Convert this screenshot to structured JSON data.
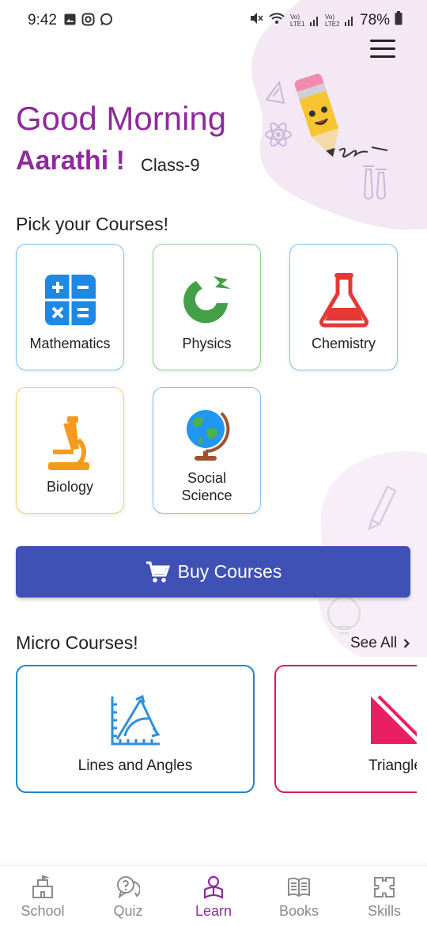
{
  "status_bar": {
    "time": "9:42",
    "battery": "78%",
    "sim1": "Vo) LTE1",
    "sim2": "Vo) LTE2",
    "left_icons": [
      "gallery-icon",
      "instagram-icon",
      "whatsapp-icon"
    ],
    "right_icons": [
      "mute-icon",
      "wifi-icon",
      "signal-icon",
      "signal-icon",
      "battery-icon"
    ]
  },
  "header": {
    "greeting": "Good Morning",
    "user_name": "Aarathi !",
    "class_label": "Class-9",
    "menu_icon": "hamburger-menu-icon"
  },
  "courses_section": {
    "title": "Pick your Courses!",
    "courses": [
      {
        "label": "Mathematics",
        "icon": "calculator-icon",
        "border_color": "#4aa7e3"
      },
      {
        "label": "Physics",
        "icon": "magnet-icon",
        "border_color": "#5cb85c"
      },
      {
        "label": "Chemistry",
        "icon": "flask-icon",
        "border_color": "#4aa7e3"
      },
      {
        "label": "Biology",
        "icon": "microscope-icon",
        "border_color": "#f2c744"
      },
      {
        "label": "Social Science",
        "icon": "globe-icon",
        "border_color": "#4aa7e3"
      }
    ]
  },
  "buy_button": {
    "label": "Buy Courses",
    "icon": "cart-icon",
    "color": "#3f51b5"
  },
  "micro_section": {
    "title": "Micro Courses!",
    "see_all": "See All",
    "items": [
      {
        "label": "Lines and Angles",
        "icon": "protractor-icon",
        "border_color": "#1e88c8"
      },
      {
        "label": "Triangle",
        "icon": "triangle-ruler-icon",
        "border_color": "#d81b60"
      }
    ]
  },
  "bottom_nav": {
    "active_color": "#8e2a9c",
    "items": [
      {
        "label": "School",
        "icon": "school-icon"
      },
      {
        "label": "Quiz",
        "icon": "quiz-icon"
      },
      {
        "label": "Learn",
        "icon": "learn-icon",
        "active": true
      },
      {
        "label": "Books",
        "icon": "books-icon"
      },
      {
        "label": "Skills",
        "icon": "puzzle-icon"
      }
    ]
  },
  "colors": {
    "brand_purple": "#8e2a9c",
    "primary_blue": "#3f51b5"
  }
}
